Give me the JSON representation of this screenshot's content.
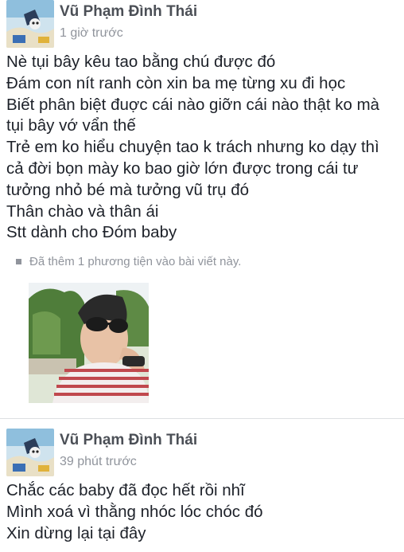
{
  "posts": [
    {
      "author": "Vũ Phạm Đình Thái",
      "time": "1 giờ trước",
      "lines": [
        "Nè tụi bây kêu tao bằng chú được đó",
        "Đám con nít ranh còn xin ba mẹ từng xu đi học",
        "Biết phân biệt đuợc cái nào giỡn cái nào thật ko mà",
        "tụi bây vớ vẩn thế",
        "Trẻ em ko hiểu chuyện tao k trách nhưng ko dạy thì",
        "cả đời bọn mày ko bao giờ lớn được trong cái tư",
        "tưởng nhỏ bé mà tưởng vũ trụ đó",
        "Thân chào và thân ái",
        "Stt dành cho Đóm baby"
      ],
      "attachment_note": "Đã thêm 1 phương tiện vào bài viết này."
    },
    {
      "author": "Vũ Phạm Đình Thái",
      "time": "39 phút trước",
      "lines": [
        "Chắc các baby đã đọc hết rồi nhĩ",
        "Mình xoá vì thằng nhóc lóc chóc đó",
        "Xin dừng lại tại đây"
      ]
    }
  ]
}
